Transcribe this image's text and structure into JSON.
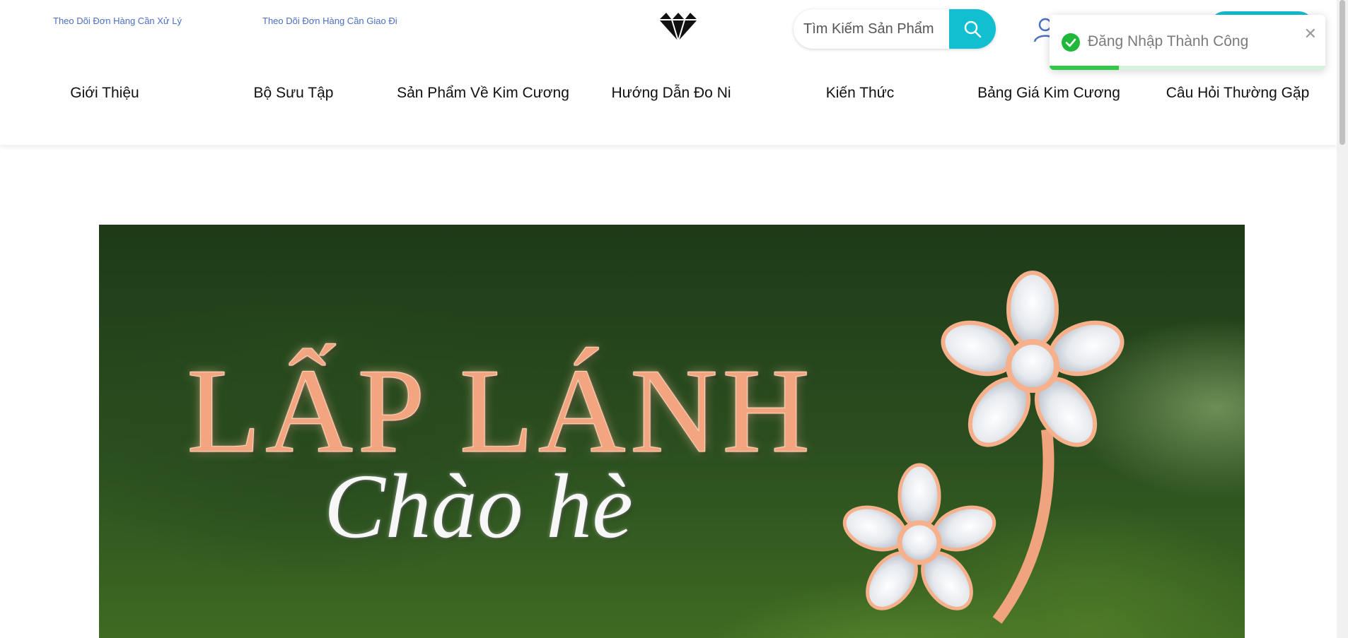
{
  "header": {
    "top_links": [
      "Theo Dõi Đơn Hàng Cần Xử Lý",
      "Theo Dõi Đơn Hàng Cần Giao Đi"
    ],
    "logo_icon": "diamond-icon",
    "search": {
      "placeholder": "Tìm Kiếm Sản Phẩm",
      "button_icon": "search-icon"
    },
    "user_icon": "user-icon",
    "nav": [
      "Giới Thiệu",
      "Bộ Sưu Tập",
      "Sản Phẩm Về Kim Cương",
      "Hướng Dẫn Đo Ni",
      "Kiến Thức",
      "Bảng Giá Kim Cương",
      "Câu Hỏi Thường Gặp"
    ]
  },
  "toast": {
    "message": "Đăng Nhập Thành Công",
    "icon": "check-circle-icon",
    "close_icon": "close-icon",
    "progress": 0.25,
    "color": "#2fcb47"
  },
  "banner": {
    "title": "LẤP LÁNH",
    "subtitle": "Chào hè"
  },
  "colors": {
    "accent": "#11bfd1",
    "link": "#4a6fc4",
    "success": "#2fcb47"
  }
}
